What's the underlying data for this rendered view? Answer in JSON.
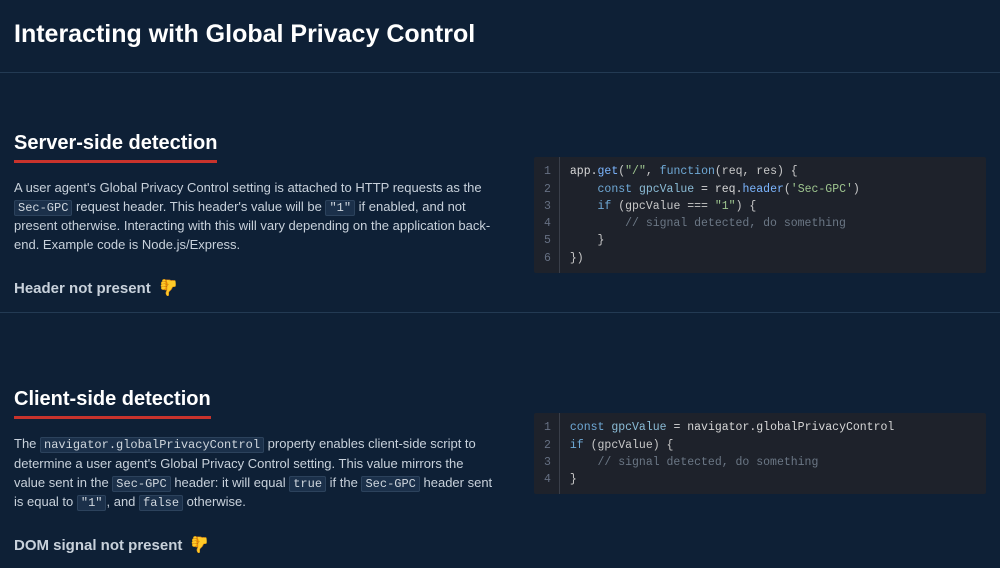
{
  "header": {
    "title": "Interacting with Global Privacy Control"
  },
  "sections": {
    "server": {
      "heading": "Server-side detection",
      "para_1a": "A user agent's Global Privacy Control setting is attached to HTTP requests as the ",
      "chip1": "Sec-GPC",
      "para_1b": " request header. This header's value will be ",
      "chip2": "\"1\"",
      "para_1c": " if enabled, and not present otherwise. Interacting with this will vary depending on the application back-end. Example code is Node.js/Express.",
      "status": "Header not present",
      "code": {
        "lines": [
          "1",
          "2",
          "3",
          "4",
          "5",
          "6"
        ],
        "l1a": "app.",
        "l1b": "get",
        "l1c": "(",
        "l1d": "\"/\"",
        "l1e": ", ",
        "l1f": "function",
        "l1g": "(req, res) {",
        "l2a": "    ",
        "l2b": "const",
        "l2c": " ",
        "l2d": "gpcValue",
        "l2e": " = req.",
        "l2f": "header",
        "l2g": "(",
        "l2h": "'Sec-GPC'",
        "l2i": ")",
        "l3a": "    ",
        "l3b": "if",
        "l3c": " (gpcValue === ",
        "l3d": "\"1\"",
        "l3e": ") {",
        "l4": "        // signal detected, do something",
        "l5": "    }",
        "l6": "})"
      }
    },
    "client": {
      "heading": "Client-side detection",
      "para_1a": "The ",
      "chip1": "navigator.globalPrivacyControl",
      "para_1b": " property enables client-side script to determine a user agent's Global Privacy Control setting. This value mirrors the value sent in the ",
      "chip2": "Sec-GPC",
      "para_1c": " header: it will equal ",
      "chip3": "true",
      "para_1d": " if the ",
      "chip4": "Sec-GPC",
      "para_1e": " header sent is equal to ",
      "chip5": "\"1\"",
      "para_1f": ", and ",
      "chip6": "false",
      "para_1g": " otherwise.",
      "status": "DOM signal not present",
      "code": {
        "lines": [
          "1",
          "2",
          "3",
          "4"
        ],
        "l1a": "const",
        "l1b": " ",
        "l1c": "gpcValue",
        "l1d": " = navigator.globalPrivacyControl",
        "l2a": "if",
        "l2b": " (gpcValue) {",
        "l3": "    // signal detected, do something",
        "l4": "}"
      }
    }
  }
}
